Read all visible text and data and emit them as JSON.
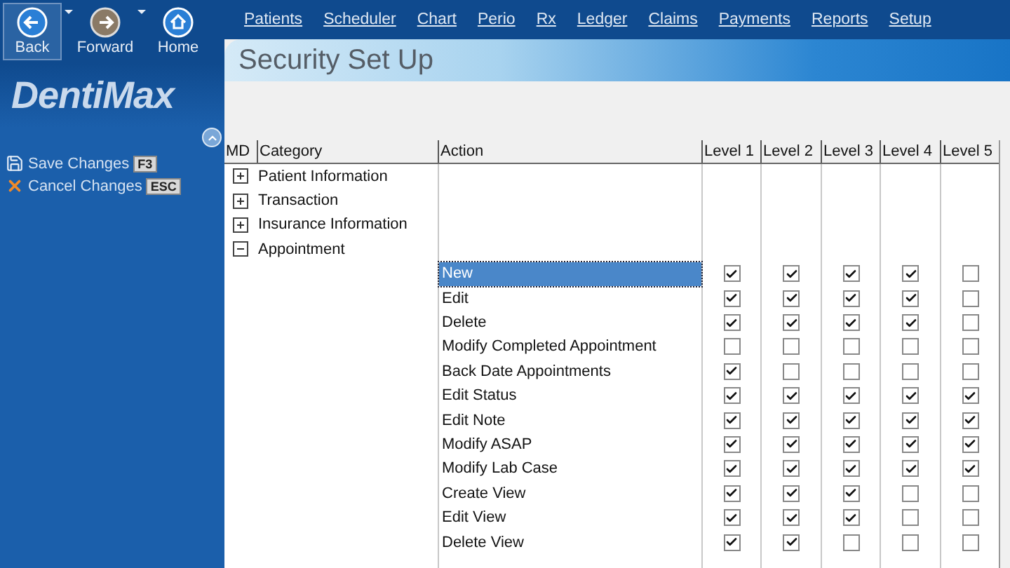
{
  "nav_buttons": [
    {
      "label": "Back",
      "kind": "back",
      "selected": true,
      "has_dropdown": true
    },
    {
      "label": "Forward",
      "kind": "forward",
      "selected": false,
      "has_dropdown": true
    },
    {
      "label": "Home",
      "kind": "home",
      "selected": false,
      "has_dropdown": false
    }
  ],
  "menu": [
    "Patients",
    "Scheduler",
    "Chart",
    "Perio",
    "Rx",
    "Ledger",
    "Claims",
    "Payments",
    "Reports",
    "Setup"
  ],
  "logo": "DentiMax",
  "sidebar_actions": [
    {
      "label": "Save Changes",
      "key": "F3",
      "kind": "save"
    },
    {
      "label": "Cancel Changes",
      "key": "ESC",
      "kind": "cancel"
    }
  ],
  "page_title": "Security Set Up",
  "table": {
    "columns": [
      "MD",
      "Category",
      "Action",
      "Level 1",
      "Level 2",
      "Level 3",
      "Level 4",
      "Level 5"
    ],
    "categories": [
      {
        "name": "Patient Information",
        "expanded": false
      },
      {
        "name": "Transaction",
        "expanded": false
      },
      {
        "name": "Insurance Information",
        "expanded": false
      },
      {
        "name": "Appointment",
        "expanded": true,
        "actions": [
          {
            "label": "New",
            "selected": true,
            "levels": [
              true,
              true,
              true,
              true,
              false
            ]
          },
          {
            "label": "Edit",
            "selected": false,
            "levels": [
              true,
              true,
              true,
              true,
              false
            ]
          },
          {
            "label": "Delete",
            "selected": false,
            "levels": [
              true,
              true,
              true,
              true,
              false
            ]
          },
          {
            "label": "Modify Completed Appointment",
            "selected": false,
            "levels": [
              false,
              false,
              false,
              false,
              false
            ]
          },
          {
            "label": "Back Date Appointments",
            "selected": false,
            "levels": [
              true,
              false,
              false,
              false,
              false
            ]
          },
          {
            "label": "Edit Status",
            "selected": false,
            "levels": [
              true,
              true,
              true,
              true,
              true
            ]
          },
          {
            "label": "Edit Note",
            "selected": false,
            "levels": [
              true,
              true,
              true,
              true,
              true
            ]
          },
          {
            "label": "Modify ASAP",
            "selected": false,
            "levels": [
              true,
              true,
              true,
              true,
              true
            ]
          },
          {
            "label": "Modify Lab Case",
            "selected": false,
            "levels": [
              true,
              true,
              true,
              true,
              true
            ]
          },
          {
            "label": "Create View",
            "selected": false,
            "levels": [
              true,
              true,
              true,
              false,
              false
            ]
          },
          {
            "label": "Edit View",
            "selected": false,
            "levels": [
              true,
              true,
              true,
              false,
              false
            ]
          },
          {
            "label": "Delete View",
            "selected": false,
            "levels": [
              true,
              true,
              false,
              false,
              false
            ]
          }
        ]
      }
    ]
  }
}
